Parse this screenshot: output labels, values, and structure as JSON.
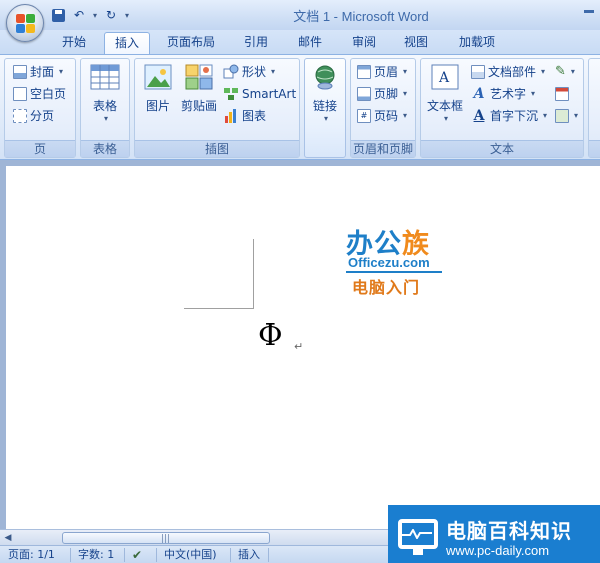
{
  "window": {
    "title": "文档 1 - Microsoft Word"
  },
  "tabs": [
    "开始",
    "插入",
    "页面布局",
    "引用",
    "邮件",
    "审阅",
    "视图",
    "加载项"
  ],
  "active_tab": "插入",
  "ribbon": {
    "page_group": {
      "label": "页",
      "cover": "封面",
      "blank_page": "空白页",
      "page_break": "分页"
    },
    "table_group": {
      "label": "表格",
      "table": "表格"
    },
    "illustrations_group": {
      "label": "插图",
      "picture": "图片",
      "clipart": "剪贴画",
      "shapes": "形状",
      "smartart": "SmartArt",
      "chart": "图表"
    },
    "links_group": {
      "link": "链接"
    },
    "header_footer_group": {
      "label": "页眉和页脚",
      "header": "页眉",
      "footer": "页脚",
      "page_number": "页码"
    },
    "text_group": {
      "label": "文本",
      "textbox": "文本框",
      "quick_parts": "文档部件",
      "wordart": "艺术字",
      "dropcap": "首字下沉"
    }
  },
  "document": {
    "symbol": "Φ",
    "para_mark": "↵",
    "watermark": {
      "line1_a": "办公",
      "line1_b": "族",
      "line2": "Officezu.com",
      "line3": "电脑入门"
    }
  },
  "statusbar": {
    "page": "页面: 1/1",
    "words": "字数: 1",
    "language": "中文(中国)",
    "mode": "插入"
  },
  "brand": {
    "title": "电脑百科知识",
    "url": "www.pc-daily.com"
  },
  "colors": {
    "ribbon_text": "#15428b",
    "brand_blue": "#1a7ed0",
    "watermark_blue": "#1e7fc8",
    "watermark_orange": "#f08a1c"
  }
}
